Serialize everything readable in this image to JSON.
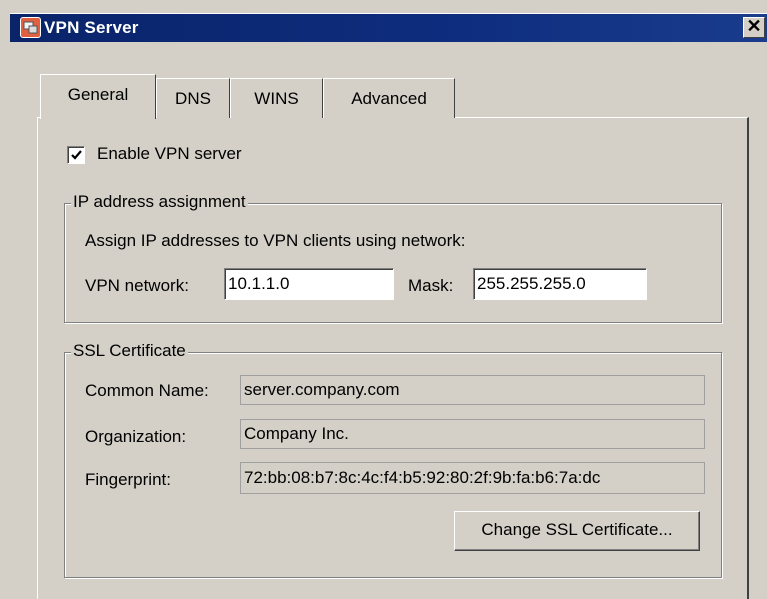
{
  "window": {
    "title": "VPN Server",
    "close_label": "✕"
  },
  "tabs": [
    {
      "label": "General",
      "active": true
    },
    {
      "label": "DNS",
      "active": false
    },
    {
      "label": "WINS",
      "active": false
    },
    {
      "label": "Advanced",
      "active": false
    }
  ],
  "general": {
    "enable_vpn": {
      "label": "Enable VPN server",
      "checked": true
    },
    "ip_assignment": {
      "group_title": "IP address assignment",
      "description": "Assign IP addresses to VPN clients using network:",
      "network_label": "VPN network:",
      "network_value": "10.1.1.0",
      "mask_label": "Mask:",
      "mask_value": "255.255.255.0"
    },
    "ssl": {
      "group_title": "SSL Certificate",
      "common_name_label": "Common Name:",
      "common_name_value": "server.company.com",
      "organization_label": "Organization:",
      "organization_value": "Company Inc.",
      "fingerprint_label": "Fingerprint:",
      "fingerprint_value": "72:bb:08:b7:8c:4c:f4:b5:92:80:2f:9b:fa:b6:7a:dc",
      "change_button": "Change SSL Certificate..."
    }
  },
  "icons": {
    "title_icon": "vpn-server-icon",
    "close": "close-icon",
    "check": "checkmark-icon"
  },
  "colors": {
    "titlebar": "#0a246a",
    "face": "#d4d0c8"
  }
}
